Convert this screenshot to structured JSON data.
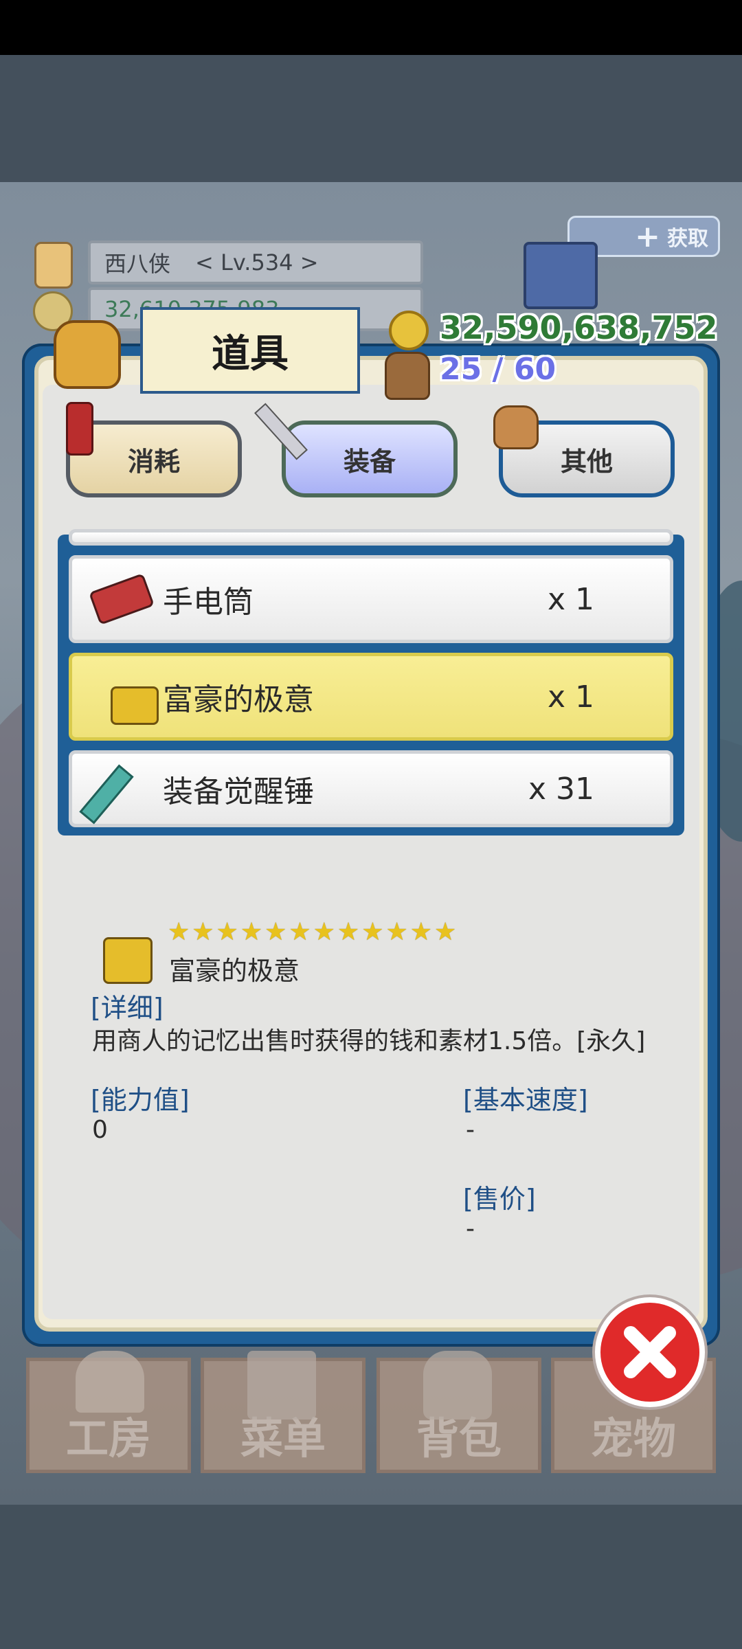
{
  "header": {
    "player_name": "西八侠",
    "player_level": "< Lv.534 >",
    "hidden_gold": "32,610,375,983",
    "get_label": "获取"
  },
  "dialog": {
    "title": "道具",
    "gold": "32,590,638,752",
    "bag_capacity": "25 / 60"
  },
  "tabs": [
    {
      "label": "消耗",
      "icon": "potion-icon",
      "selected": false
    },
    {
      "label": "装备",
      "icon": "sword-icon",
      "selected": true
    },
    {
      "label": "其他",
      "icon": "sack-icon",
      "selected": false
    }
  ],
  "items": [
    {
      "name": "手电筒",
      "qty": "x 1",
      "icon": "flashlight-icon",
      "selected": false
    },
    {
      "name": "富豪的极意",
      "qty": "x 1",
      "icon": "gold-chest-icon",
      "selected": true
    },
    {
      "name": "装备觉醒锤",
      "qty": "x 31",
      "icon": "hammer-icon",
      "selected": false
    }
  ],
  "detail": {
    "stars_count": 12,
    "item_name": "富豪的极意",
    "desc_head": "[详细]",
    "desc": "用商人的记忆出售时获得的钱和素材1.5倍。[永久]",
    "ability_head": "[能力值]",
    "ability_value": "0",
    "speed_head": "[基本速度]",
    "speed_value": "-",
    "price_head": "[售价]",
    "price_value": "-"
  },
  "nav": [
    {
      "label": "工房",
      "icon": "workshop-icon"
    },
    {
      "label": "菜单",
      "icon": "book-icon"
    },
    {
      "label": "背包",
      "icon": "backpack-icon"
    },
    {
      "label": "宠物",
      "icon": "pet-icon"
    }
  ],
  "colors": {
    "dialog_blue": "#1f5f97",
    "gold_green": "#2f7b36",
    "bag_purple": "#6b70e6",
    "selected_row": "#f3e885"
  }
}
